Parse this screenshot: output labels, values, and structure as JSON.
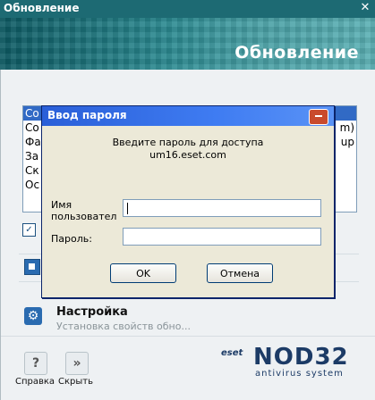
{
  "window": {
    "title": "Обновление",
    "close_label": "✕"
  },
  "banner": {
    "title": "Обновление"
  },
  "list": {
    "items": [
      {
        "label": "Со",
        "right": ""
      },
      {
        "label": "Со",
        "right": "m)"
      },
      {
        "label": "Фа",
        "right": "up"
      },
      {
        "label": "За",
        "right": ""
      },
      {
        "label": "Ск",
        "right": ""
      },
      {
        "label": "Ос",
        "right": ""
      }
    ]
  },
  "checkbox": {
    "mark": "✓"
  },
  "settings": {
    "title": "Настройка",
    "subtitle": "Установка свойств обно..."
  },
  "bottom": {
    "help_label": "Справка",
    "hide_label": "Скрыть",
    "help_icon": "?",
    "hide_icon": "»"
  },
  "brand": {
    "eset": "eset",
    "product": "NOD32",
    "tagline": "antivirus system"
  },
  "dialog": {
    "title": "Ввод пароля",
    "message": "Введите пароль для доступа",
    "host": "um16.eset.com",
    "user_label": "Имя пользовател",
    "user_value": "",
    "password_label": "Пароль:",
    "password_value": "",
    "ok_label": "OK",
    "cancel_label": "Отмена"
  },
  "colors": {
    "accent": "#1d6a73",
    "dialog_title": "#2a5fd8",
    "selection": "#316ac5"
  }
}
